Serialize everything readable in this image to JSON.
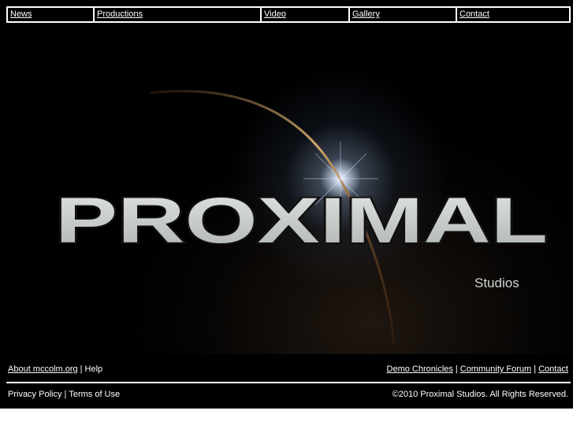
{
  "nav": {
    "items": [
      {
        "label": "News"
      },
      {
        "label": "Productions"
      },
      {
        "label": "Video"
      },
      {
        "label": "Gallery"
      },
      {
        "label": "Contact"
      }
    ]
  },
  "hero": {
    "logo_word": "PROXIMAL",
    "logo_sub": "Studios"
  },
  "footer": {
    "left_links": [
      {
        "label": "About mccolm.org"
      },
      {
        "label": "Help"
      }
    ],
    "right_links": [
      {
        "label": "Demo Chronicles"
      },
      {
        "label": "Community Forum"
      },
      {
        "label": "Contact"
      }
    ],
    "separator": "|",
    "privacy_label": "Privacy Policy",
    "terms_label": "Terms of Use",
    "copyright": "©2010 Proximal Studios. All Rights Reserved."
  },
  "colors": {
    "background": "#000000",
    "text": "#ffffff",
    "logo_fill": "#c9cdca"
  }
}
